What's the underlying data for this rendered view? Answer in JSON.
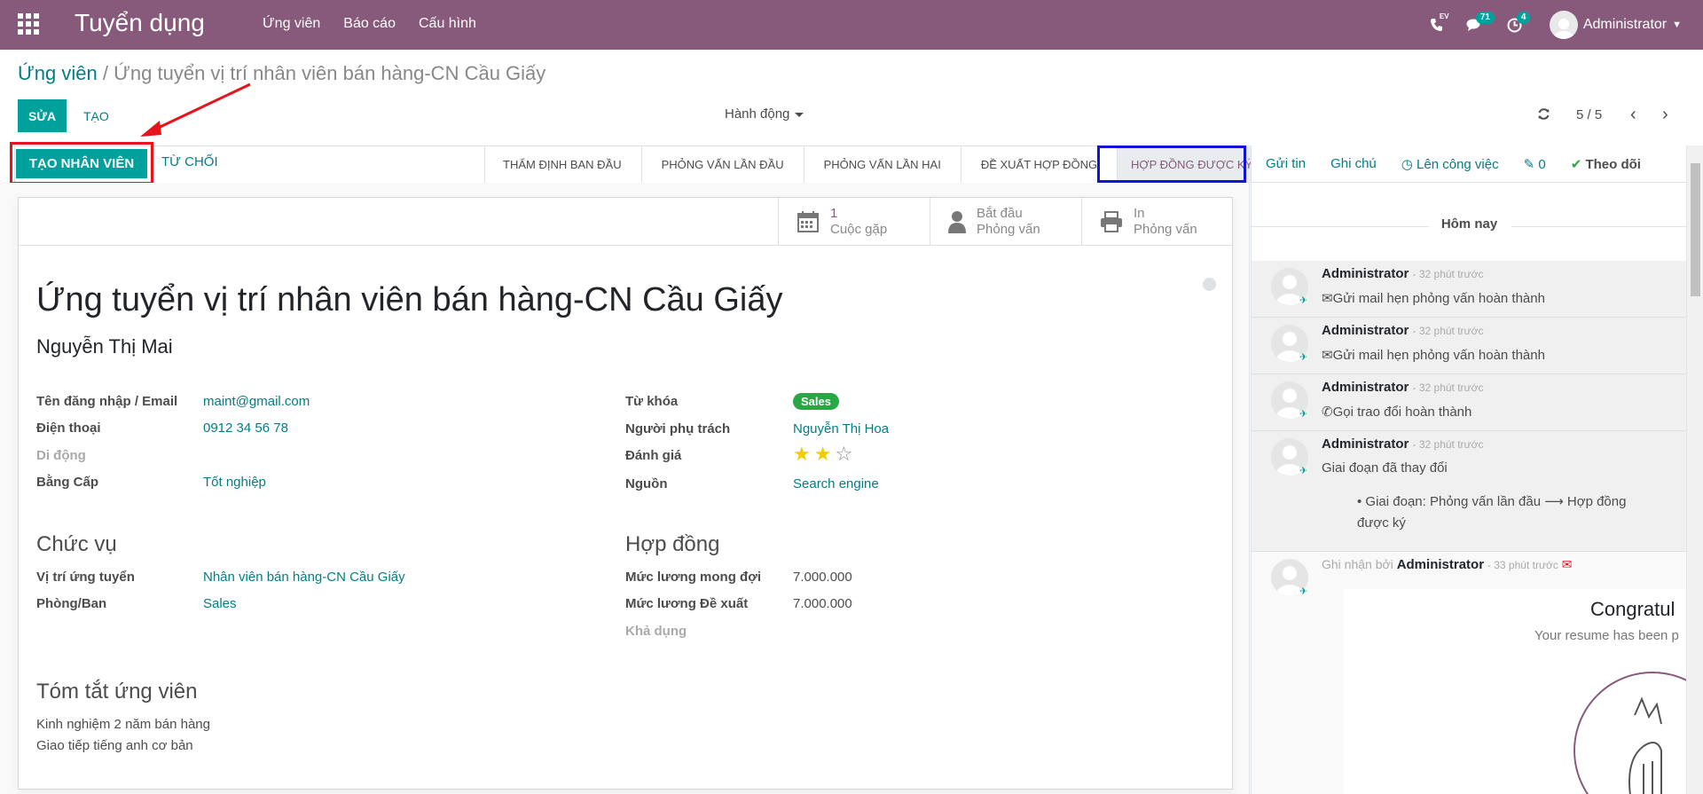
{
  "navbar": {
    "brand": "Tuyển dụng",
    "menu": [
      "Ứng viên",
      "Báo cáo",
      "Cấu hình"
    ],
    "phone_tag": "EV",
    "messages_count": "71",
    "activities_count": "4",
    "user": "Administrator"
  },
  "breadcrumb": {
    "parent": "Ứng viên",
    "separator": "/",
    "current": "Ứng tuyển vị trí nhân viên bán hàng-CN Cầu Giấy"
  },
  "controls": {
    "edit": "SỬA",
    "create": "TẠO",
    "actions": "Hành động",
    "pager": "5 / 5"
  },
  "statusbar": {
    "create_employee": "TẠO NHÂN VIÊN",
    "refuse": "TỪ CHỐI",
    "stages": [
      "THẨM ĐỊNH BAN ĐẦU",
      "PHỎNG VẤN LẦN ĐẦU",
      "PHỎNG VẤN LẦN HAI",
      "ĐỀ XUẤT HỢP ĐỒNG",
      "HỢP ĐỒNG ĐƯỢC KÝ"
    ],
    "active_stage": "HỢP ĐỒNG ĐƯỢC KÝ"
  },
  "smart_buttons": {
    "meeting_count": "1",
    "meeting_label": "Cuộc gặp",
    "interview_line1": "Bắt đầu",
    "interview_line2": "Phỏng vấn",
    "print_line1": "In",
    "print_line2": "Phỏng vấn"
  },
  "form": {
    "title": "Ứng tuyển vị trí nhân viên bán hàng-CN Cầu Giấy",
    "applicant_name": "Nguyễn Thị Mai",
    "email_label": "Tên đăng nhập / Email",
    "email": "maint@gmail.com",
    "phone_label": "Điện thoại",
    "phone": "0912 34 56 78",
    "mobile_label": "Di động",
    "degree_label": "Bằng Cấp",
    "degree": "Tốt nghiệp",
    "tags_label": "Từ khóa",
    "tag": "Sales",
    "responsible_label": "Người phụ trách",
    "responsible": "Nguyễn Thị Hoa",
    "rating_label": "Đánh giá",
    "rating": 2,
    "rating_max": 3,
    "source_label": "Nguồn",
    "source": "Search engine",
    "job_section": "Chức vụ",
    "position_label": "Vị trí ứng tuyển",
    "position": "Nhân viên bán hàng-CN Cầu Giấy",
    "department_label": "Phòng/Ban",
    "department": "Sales",
    "contract_section": "Hợp đồng",
    "expected_salary_label": "Mức lương mong đợi",
    "expected_salary": "7.000.000",
    "proposed_salary_label": "Mức lương Đề xuất",
    "proposed_salary": "7.000.000",
    "availability_label": "Khả dụng",
    "summary_section": "Tóm tắt ứng viên",
    "summary_line1": "Kinh nghiệm 2 năm bán hàng",
    "summary_line2": "Giao tiếp tiếng anh cơ bản"
  },
  "chatter": {
    "send_message": "Gửi tin",
    "log_note": "Ghi chú",
    "schedule_activity": "Lên công việc",
    "attachments": "0",
    "follow": "Theo dõi",
    "today": "Hôm nay",
    "messages": [
      {
        "author": "Administrator",
        "time": "- 32 phút trước",
        "body": "Gửi mail hẹn phỏng vấn hoàn thành"
      },
      {
        "author": "Administrator",
        "time": "- 32 phút trước",
        "body": "Gửi mail hẹn phỏng vấn hoàn thành"
      },
      {
        "author": "Administrator",
        "time": "- 32 phút trước",
        "body": "Gọi trao đổi hoàn thành"
      },
      {
        "author": "Administrator",
        "time": "- 32 phút trước",
        "body": "Giai đoạn đã thay đổi",
        "change": "Giai đoạn: Phỏng vấn lần đầu ⟶ Hợp đồng được ký"
      }
    ],
    "logged_by": "Ghi nhận bởi",
    "logged_author": "Administrator",
    "logged_time": "- 33 phút trước",
    "mail_heading": "Congratul",
    "mail_text": "Your resume has been p"
  },
  "colors": {
    "navbar": "#875a7b",
    "primary": "#00a09d",
    "link": "#017e84",
    "tag_green": "#28a745",
    "highlight_red": "#e8121b",
    "highlight_blue": "#1114d8"
  }
}
